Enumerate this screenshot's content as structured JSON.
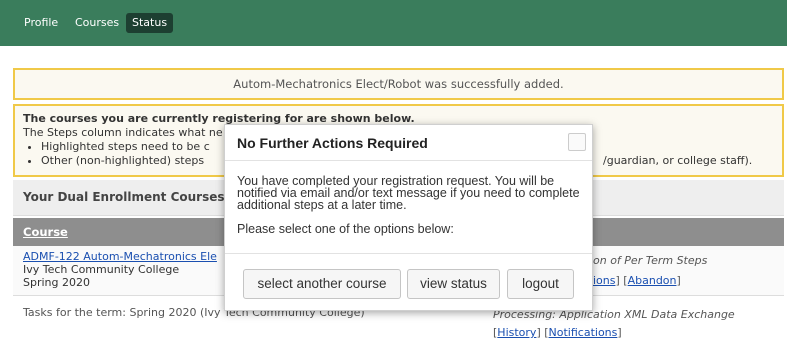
{
  "nav": {
    "items": [
      {
        "label": "Profile"
      },
      {
        "label": "Courses"
      },
      {
        "label": "Status",
        "active": true
      }
    ]
  },
  "notice": {
    "text": "Autom-Mechatronics Elect/Robot was successfully added."
  },
  "info": {
    "line1": "The courses you are currently registering for are shown below.",
    "line2": "The Steps column indicates what ne",
    "bullet1": "Highlighted steps need to be c",
    "bullet2": "Other (non-highlighted) steps",
    "bullet2_tail": "/guardian, or college staff)."
  },
  "enrollment": {
    "heading": "Your Dual Enrollment Courses",
    "column_course": "Course"
  },
  "course_row": {
    "course_link": "ADMF-122 Autom-Mechatronics Ele",
    "college": "Ivy Tech Community College",
    "term": "Spring 2020",
    "step_text": "on of Per Term Steps",
    "link_actions": "ions",
    "link_abandon": "Abandon"
  },
  "tasks_row": {
    "text": "Tasks for the term: Spring 2020 (Ivy Tech Community College)",
    "step_text": "Processing: Application XML Data Exchange",
    "link_history": "History",
    "link_notifications": "Notifications"
  },
  "modal": {
    "title": "No Further Actions Required",
    "message": "You have completed your registration request. You will be notified via email and/or text message if you need to complete additional steps at a later time.",
    "prompt": "Please select one of the options below:",
    "buttons": {
      "select_another": "select another course",
      "view_status": "view status",
      "logout": "logout"
    }
  },
  "colors": {
    "nav_bg": "#3a7d5c",
    "nav_active": "#1d3f31",
    "notice_border": "#f0c948",
    "link": "#1a4fb0"
  }
}
